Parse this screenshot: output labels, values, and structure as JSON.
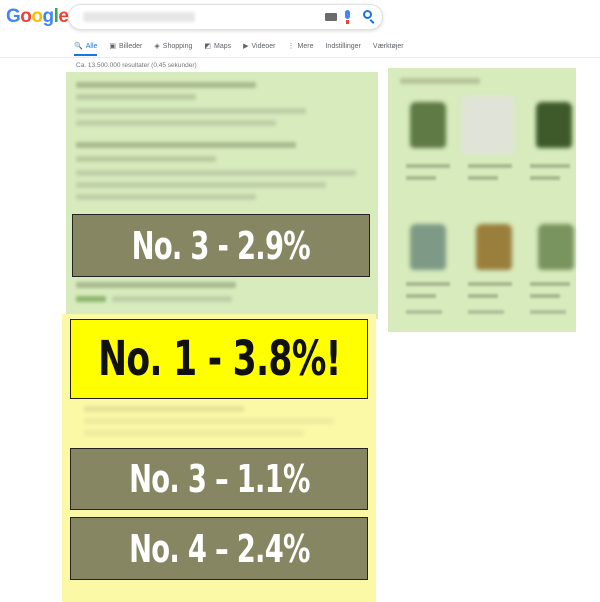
{
  "header": {
    "logo_letters": [
      {
        "char": "G",
        "color": "#4285f4"
      },
      {
        "char": "o",
        "color": "#ea4335"
      },
      {
        "char": "o",
        "color": "#fbbc05"
      },
      {
        "char": "g",
        "color": "#4285f4"
      },
      {
        "char": "l",
        "color": "#34a853"
      },
      {
        "char": "e",
        "color": "#ea4335"
      }
    ],
    "search": {
      "value": "",
      "keyboard_icon": "keyboard-icon",
      "mic_icon": "mic-icon",
      "search_icon": "search-icon"
    }
  },
  "tabs": [
    {
      "label": "Alle",
      "icon": "search-icon",
      "glyph": "🔍",
      "active": true
    },
    {
      "label": "Billeder",
      "icon": "image-icon",
      "glyph": "▣",
      "active": false
    },
    {
      "label": "Shopping",
      "icon": "tag-icon",
      "glyph": "◈",
      "active": false
    },
    {
      "label": "Maps",
      "icon": "map-icon",
      "glyph": "◩",
      "active": false
    },
    {
      "label": "Videoer",
      "icon": "play-icon",
      "glyph": "▶",
      "active": false
    },
    {
      "label": "Mere",
      "icon": "more-icon",
      "glyph": "⋮",
      "active": false
    },
    {
      "label": "Indstillinger",
      "icon": "",
      "glyph": "",
      "active": false
    },
    {
      "label": "Værktøjer",
      "icon": "",
      "glyph": "",
      "active": false
    }
  ],
  "results_stats": "Ca. 13.500.000 resultater (0,45 sekunder)",
  "heatmap_labels": {
    "top_left": "No. 3 - 2.9%",
    "top_ad": "No. 1 - 3.8%!",
    "middle": "No. 3 – 1.1%",
    "bottom": "No. 4 – 2.4%"
  },
  "colors": {
    "heat_green": "#d7ebbd",
    "heat_yellow": "#fbf8a6",
    "label_gray": "#868662",
    "label_yellow": "#ffff00",
    "accent_blue": "#1a73e8"
  }
}
